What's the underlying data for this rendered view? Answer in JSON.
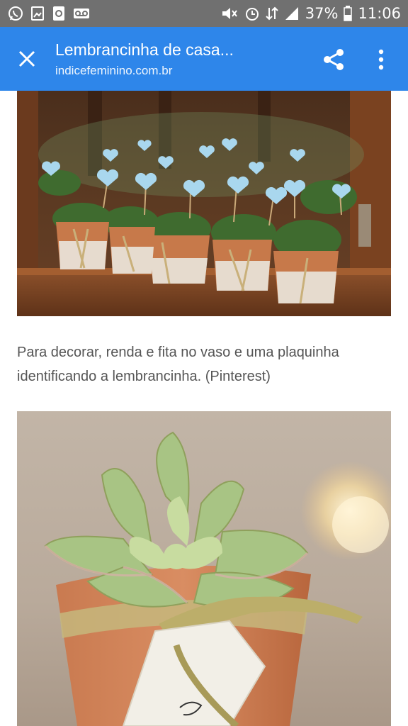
{
  "status_bar": {
    "battery_percent": "37%",
    "time": "11:06",
    "left_icons": [
      "whatsapp-icon",
      "image-icon",
      "recycle-icon",
      "voicemail-icon"
    ],
    "right_icons": [
      "mute-icon",
      "alarm-icon",
      "data-icon",
      "signal-icon",
      "battery-icon"
    ]
  },
  "app_bar": {
    "title": "Lembrancinha de casa...",
    "url": "indicefeminino.com.br",
    "color": "#2e86ea"
  },
  "article": {
    "caption_line1": "Para decorar, renda e fita no vaso e uma plaquinha",
    "caption_line2": "identificando a lembrancinha. (Pinterest)"
  }
}
